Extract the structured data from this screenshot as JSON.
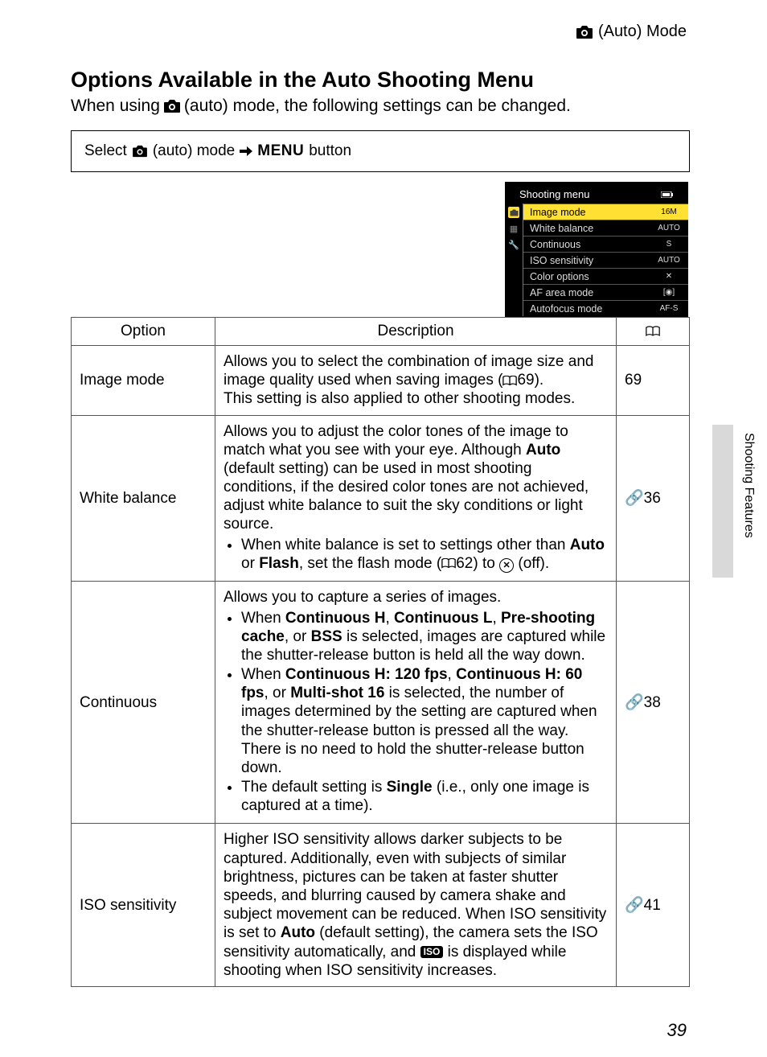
{
  "header": {
    "mode_label": "(Auto) Mode"
  },
  "title": "Options Available in the Auto Shooting Menu",
  "intro": {
    "pre": "When using ",
    "post": " (auto) mode, the following settings can be changed."
  },
  "select_box": {
    "pre": "Select ",
    "mid": " (auto) mode ",
    "menu_word": "MENU",
    "post": " button"
  },
  "screen": {
    "title": "Shooting menu",
    "items": [
      {
        "label": "Image mode",
        "val": "16M",
        "selected": true
      },
      {
        "label": "White balance",
        "val": "AUTO"
      },
      {
        "label": "Continuous",
        "val": "S"
      },
      {
        "label": "ISO sensitivity",
        "val": "AUTO"
      },
      {
        "label": "Color options",
        "val": "✕"
      },
      {
        "label": "AF area mode",
        "val": "[◉]"
      },
      {
        "label": "Autofocus mode",
        "val": "AF-S"
      }
    ]
  },
  "table": {
    "head": {
      "c1": "Option",
      "c2": "Description"
    },
    "rows": [
      {
        "option": "Image mode",
        "ref_type": "page",
        "ref": "69",
        "desc": {
          "p1a": "Allows you to select the combination of image size and image quality used when saving images (",
          "p1b": "69).",
          "p2": "This setting is also applied to other shooting modes."
        }
      },
      {
        "option": "White balance",
        "ref_type": "link",
        "ref": "36",
        "desc": {
          "p1a": "Allows you to adjust the color tones of the image to match what you see with your eye. Although ",
          "b1": "Auto",
          "p1b": " (default setting) can be used in most shooting conditions, if the desired color tones are not achieved, adjust white balance to suit the sky conditions or light source.",
          "bul": [
            {
              "a": "When white balance is set to settings other than ",
              "b1": "Auto",
              "mid": " or ",
              "b2": "Flash",
              "c": ", set the flash mode (",
              "ref": "62",
              "d": ") to ",
              "e": " (off)."
            }
          ]
        }
      },
      {
        "option": "Continuous",
        "ref_type": "link",
        "ref": "38",
        "desc": {
          "p1": "Allows you to capture a series of images.",
          "bul": [
            {
              "a": "When ",
              "b1": "Continuous H",
              "m1": ", ",
              "b2": "Continuous L",
              "m2": ", ",
              "b3": "Pre-shooting cache",
              "m3": ", or ",
              "b4": "BSS",
              "c": " is selected, images are captured while the shutter-release button is held all the way down."
            },
            {
              "a": "When ",
              "b1": "Continuous H: 120 fps",
              "m1": ", ",
              "b2": "Continuous H: 60 fps",
              "m2": ", or ",
              "b3": "Multi-shot 16",
              "c": " is selected, the number of images determined by the setting are captured when the shutter-release button is pressed all the way. There is no need to hold the shutter-release button down."
            },
            {
              "a": "The default setting is ",
              "b1": "Single",
              "c": " (i.e., only one image is captured at a time)."
            }
          ]
        }
      },
      {
        "option": "ISO sensitivity",
        "ref_type": "link",
        "ref": "41",
        "desc": {
          "p1a": "Higher ISO sensitivity allows darker subjects to be captured. Additionally, even with subjects of similar brightness, pictures can be taken at faster shutter speeds, and blurring caused by camera shake and subject movement can be reduced. When ISO sensitivity is set to ",
          "b1": "Auto",
          "p1b": " (default setting), the camera sets the ISO sensitivity automatically, and ",
          "iso": "ISO",
          "p1c": " is displayed while shooting when ISO sensitivity increases."
        }
      }
    ]
  },
  "side": "Shooting Features",
  "page_num": "39"
}
